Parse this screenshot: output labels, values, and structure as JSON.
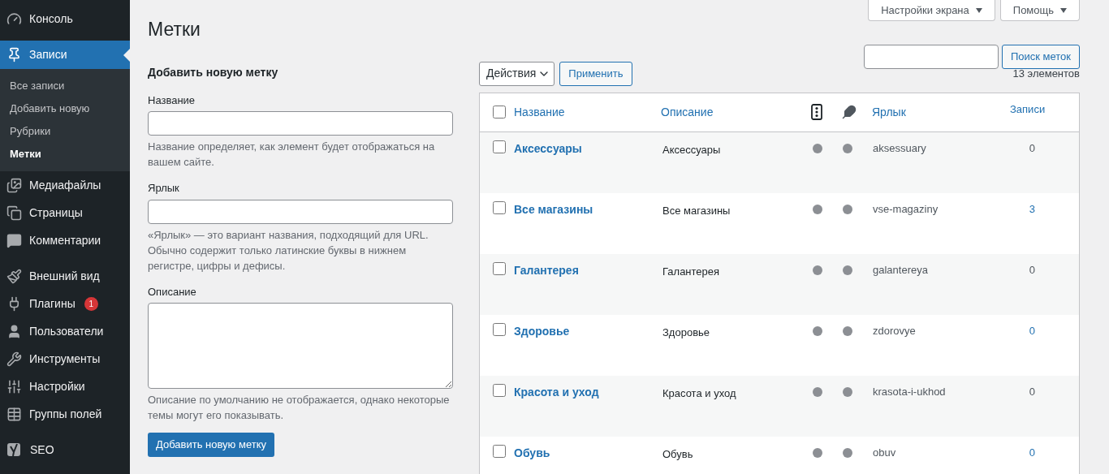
{
  "sidebar": {
    "groups": [
      [
        {
          "label": "Консоль",
          "selected": false
        }
      ],
      [
        {
          "label": "Записи",
          "selected": true,
          "children": [
            {
              "label": "Все записи",
              "selected": false
            },
            {
              "label": "Добавить новую",
              "selected": false
            },
            {
              "label": "Рубрики",
              "selected": false
            },
            {
              "label": "Метки",
              "selected": true
            }
          ]
        },
        {
          "label": "Медиафайлы",
          "selected": false
        },
        {
          "label": "Страницы",
          "selected": false
        },
        {
          "label": "Комментарии",
          "selected": false
        }
      ],
      [
        {
          "label": "Внешний вид",
          "selected": false
        },
        {
          "label": "Плагины",
          "selected": false,
          "badge": "1"
        },
        {
          "label": "Пользователи",
          "selected": false
        },
        {
          "label": "Инструменты",
          "selected": false
        },
        {
          "label": "Настройки",
          "selected": false
        },
        {
          "label": "Группы полей",
          "selected": false
        }
      ],
      [
        {
          "label": "SEO",
          "selected": false
        }
      ]
    ]
  },
  "page_title": "Метки",
  "top_buttons": [
    "Настройки экрана",
    "Помощь"
  ],
  "search": {
    "button": "Поиск меток"
  },
  "add_form": {
    "heading": "Добавить новую метку",
    "fields": [
      {
        "kind": "input",
        "label": "Название",
        "help": "Название определяет, как элемент будет отображаться на вашем сайте."
      },
      {
        "kind": "input",
        "label": "Ярлык",
        "help": "«Ярлык» — это вариант названия, подходящий для URL. Обычно содержит только латинские буквы в нижнем регистре, цифры и дефисы."
      },
      {
        "kind": "textarea",
        "label": "Описание",
        "help": "Описание по умолчанию не отображается, однако некоторые темы могут его показывать."
      }
    ],
    "submit": "Добавить новую метку"
  },
  "bulk": {
    "select": "Действия",
    "apply": "Применить",
    "count": "13 элементов"
  },
  "table": {
    "all_checked": false,
    "columns": [
      "Название",
      "Описание",
      "Ярлык",
      "Записи"
    ],
    "rows": [
      {
        "name": "Аксессуары",
        "description": "Аксессуары",
        "slug": "aksessuary",
        "count": "0",
        "count_link": false,
        "checked": false
      },
      {
        "name": "Все магазины",
        "description": "Все магазины",
        "slug": "vse-magaziny",
        "count": "3",
        "count_link": true,
        "checked": false
      },
      {
        "name": "Галантерея",
        "description": "Галантерея",
        "slug": "galantereya",
        "count": "0",
        "count_link": false,
        "checked": false
      },
      {
        "name": "Здоровье",
        "description": "Здоровье",
        "slug": "zdorovye",
        "count": "0",
        "count_link": true,
        "checked": false
      },
      {
        "name": "Красота и уход",
        "description": "Красота и уход",
        "slug": "krasota-i-ukhod",
        "count": "0",
        "count_link": false,
        "checked": false
      },
      {
        "name": "Обувь",
        "description": "Обувь",
        "slug": "obuv",
        "count": "0",
        "count_link": true,
        "checked": false
      }
    ]
  }
}
